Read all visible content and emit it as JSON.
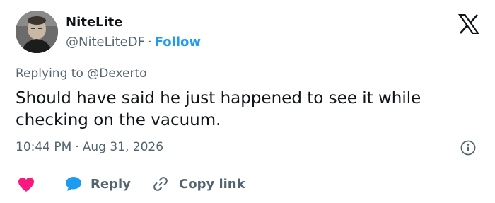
{
  "author": {
    "name": "NiteLite",
    "handle": "@NiteLiteDF",
    "separator": "·",
    "follow_label": "Follow",
    "avatar_icon": "user-avatar-photo"
  },
  "brand": {
    "logo_icon": "x-logo"
  },
  "reply_context": {
    "prefix": "Replying to",
    "mention": "@Dexerto"
  },
  "post": {
    "text": "Should have said he just happened to see it while checking on the vacuum."
  },
  "meta": {
    "time": "10:44 PM",
    "separator": "·",
    "date": "Aug 31, 2026",
    "info_icon": "info-icon"
  },
  "actions": {
    "like_icon": "heart-icon",
    "reply_label": "Reply",
    "copy_label": "Copy link"
  },
  "colors": {
    "accent": "#1d9bf0",
    "like": "#f91880",
    "text": "#0f1419",
    "muted": "#536471",
    "divider": "#cfd9de"
  }
}
